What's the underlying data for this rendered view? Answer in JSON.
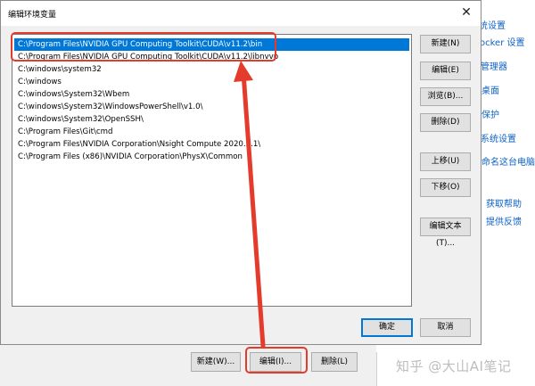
{
  "background_window": {
    "links": [
      "统设置",
      "ocker 设置",
      "管理器",
      "桌面",
      "保护",
      "系统设置",
      "命名这台电脑",
      "获取帮助",
      "提供反馈"
    ],
    "buttons": {
      "new": "新建(W)...",
      "edit": "编辑(I)...",
      "delete": "删除(L)"
    }
  },
  "dialog": {
    "title": "编辑环境变量",
    "close_glyph": "✕",
    "entries": [
      "C:\\Program Files\\NVIDIA GPU Computing Toolkit\\CUDA\\v11.2\\bin",
      "C:\\Program Files\\NVIDIA GPU Computing Toolkit\\CUDA\\v11.2\\libnvvp",
      "C:\\windows\\system32",
      "C:\\windows",
      "C:\\windows\\System32\\Wbem",
      "C:\\windows\\System32\\WindowsPowerShell\\v1.0\\",
      "C:\\windows\\System32\\OpenSSH\\",
      "C:\\Program Files\\Git\\cmd",
      "C:\\Program Files\\NVIDIA Corporation\\Nsight Compute 2020.3.1\\",
      "C:\\Program Files (x86)\\NVIDIA Corporation\\PhysX\\Common"
    ],
    "selected_index": 0,
    "buttons": {
      "new": "新建(N)",
      "edit": "编辑(E)",
      "browse": "浏览(B)...",
      "delete": "删除(D)",
      "move_up": "上移(U)",
      "move_down": "下移(O)",
      "edit_text": "编辑文本(T)...",
      "ok": "确定",
      "cancel": "取消"
    }
  },
  "annotation": {
    "color": "#e53b2c"
  },
  "watermark": "知乎 @大山AI笔记"
}
